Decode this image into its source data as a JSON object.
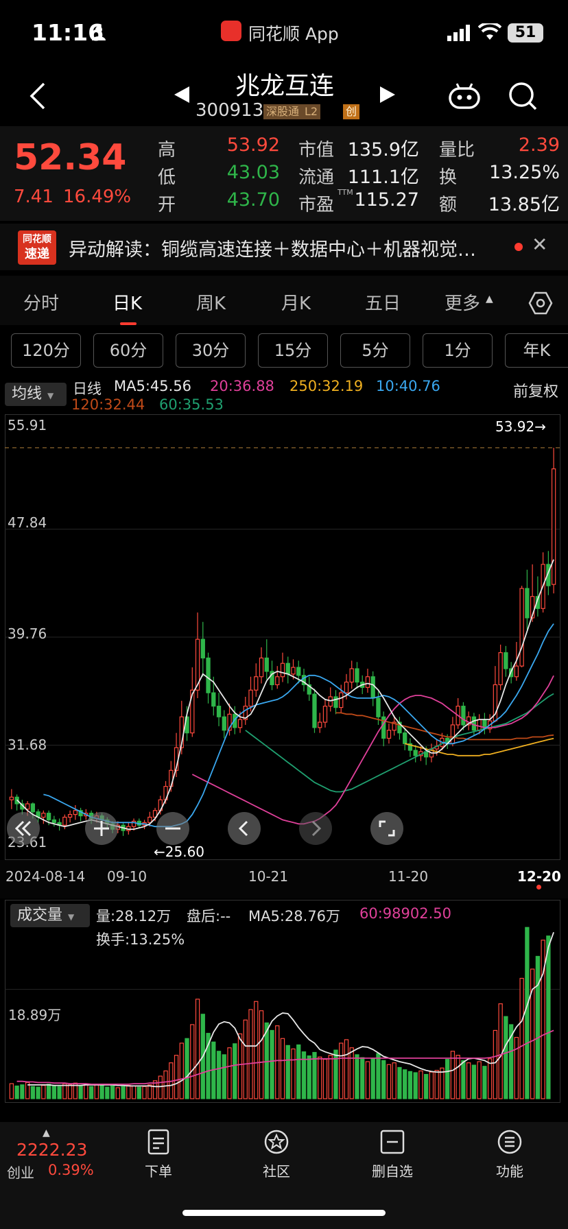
{
  "status_bar": {
    "time": "11:16",
    "app_name": "同花顺 App",
    "battery": "51"
  },
  "header": {
    "stock_name": "兆龙互连",
    "stock_code": "300913",
    "tags": [
      "深股通",
      "L2",
      "创"
    ]
  },
  "quote": {
    "price": "52.34",
    "change": "7.41",
    "change_pct": "16.49%",
    "fields": [
      {
        "label": "高",
        "value": "53.92",
        "color": "red"
      },
      {
        "label": "低",
        "value": "43.03",
        "color": "green"
      },
      {
        "label": "开",
        "value": "43.70",
        "color": "green"
      },
      {
        "label": "市值",
        "value": "135.9亿",
        "color": "white"
      },
      {
        "label": "流通",
        "value": "111.1亿",
        "color": "white"
      },
      {
        "label": "市盈",
        "sup": "TTM",
        "value": "115.27",
        "color": "white"
      },
      {
        "label": "量比",
        "value": "2.39",
        "color": "red"
      },
      {
        "label": "换",
        "value": "13.25%",
        "color": "white"
      },
      {
        "label": "额",
        "value": "13.85亿",
        "color": "white"
      }
    ]
  },
  "news": {
    "badge_top": "同花顺",
    "badge_bottom": "速递",
    "text": "异动解读：铜缆高速连接＋数据中心＋机器视觉…"
  },
  "period_tabs": [
    "分时",
    "日K",
    "周K",
    "月K",
    "五日",
    "更多"
  ],
  "minute_buttons": [
    "120分",
    "60分",
    "30分",
    "15分",
    "5分",
    "1分",
    "年K"
  ],
  "ma_legend": {
    "selector": "均线",
    "prefix": "日线",
    "items": [
      {
        "label": "MA5:45.56",
        "color": "#e8e8e8"
      },
      {
        "label": "20:36.88",
        "color": "#e0409a"
      },
      {
        "label": "250:32.19",
        "color": "#f0b020"
      },
      {
        "label": "10:40.76",
        "color": "#3aa8f0"
      },
      {
        "label": "120:32.44",
        "color": "#c04a18"
      },
      {
        "label": "60:35.53",
        "color": "#1fa070"
      }
    ],
    "fuquan": "前复权"
  },
  "chart_data": {
    "type": "candlestick",
    "y_ticks": [
      "55.91",
      "47.84",
      "39.76",
      "31.68",
      "23.61"
    ],
    "ylim": [
      23.61,
      55.91
    ],
    "x_ticks": [
      "2024-08-14",
      "09-10",
      "10-21",
      "11-20",
      "12-20"
    ],
    "high_marker": "53.92→",
    "low_marker": "←25.60",
    "candles": [
      [
        27.6,
        27.8,
        26.9,
        28.4
      ],
      [
        27.8,
        27.3,
        26.8,
        28.0
      ],
      [
        27.3,
        26.9,
        26.5,
        27.6
      ],
      [
        26.9,
        27.3,
        26.4,
        27.5
      ],
      [
        27.3,
        26.7,
        26.2,
        27.4
      ],
      [
        26.7,
        26.3,
        25.9,
        26.9
      ],
      [
        26.3,
        26.6,
        25.8,
        26.8
      ],
      [
        26.6,
        26.1,
        25.7,
        26.8
      ],
      [
        26.1,
        25.9,
        25.6,
        26.4
      ],
      [
        25.9,
        25.7,
        25.3,
        26.2
      ],
      [
        25.7,
        26.3,
        25.4,
        26.5
      ],
      [
        26.3,
        26.5,
        25.9,
        26.8
      ],
      [
        26.5,
        26.8,
        26.1,
        27.2
      ],
      [
        26.8,
        26.4,
        26.0,
        27.0
      ],
      [
        26.4,
        26.6,
        26.1,
        26.9
      ],
      [
        26.6,
        26.2,
        25.8,
        26.8
      ],
      [
        26.2,
        26.4,
        25.9,
        26.7
      ],
      [
        26.4,
        26.1,
        25.7,
        26.6
      ],
      [
        26.1,
        25.8,
        25.5,
        26.3
      ],
      [
        25.8,
        25.4,
        25.1,
        26.0
      ],
      [
        25.4,
        25.7,
        25.1,
        26.0
      ],
      [
        25.7,
        25.3,
        24.9,
        25.9
      ],
      [
        25.3,
        25.6,
        25.0,
        25.9
      ],
      [
        25.6,
        26.0,
        25.3,
        26.2
      ],
      [
        26.0,
        25.7,
        25.5,
        26.2
      ],
      [
        25.7,
        25.9,
        25.4,
        26.1
      ],
      [
        25.9,
        26.3,
        25.6,
        26.7
      ],
      [
        26.3,
        26.8,
        26.0,
        27.0
      ],
      [
        26.8,
        27.6,
        26.5,
        27.9
      ],
      [
        27.6,
        28.6,
        27.3,
        29.0
      ],
      [
        28.6,
        29.8,
        28.2,
        30.5
      ],
      [
        29.8,
        31.5,
        29.3,
        32.6
      ],
      [
        31.5,
        33.8,
        31.0,
        35.0
      ],
      [
        33.8,
        32.6,
        32.0,
        34.6
      ],
      [
        32.6,
        35.8,
        32.3,
        37.5
      ],
      [
        35.8,
        39.6,
        35.2,
        41.6
      ],
      [
        39.6,
        38.2,
        36.8,
        40.9
      ],
      [
        38.2,
        35.6,
        34.8,
        38.6
      ],
      [
        35.6,
        34.6,
        33.9,
        36.8
      ],
      [
        34.6,
        33.8,
        33.1,
        35.6
      ],
      [
        33.8,
        32.8,
        32.2,
        34.3
      ],
      [
        32.8,
        34.0,
        32.4,
        34.8
      ],
      [
        34.0,
        33.0,
        32.5,
        34.6
      ],
      [
        33.0,
        33.6,
        32.6,
        34.2
      ],
      [
        33.6,
        34.6,
        33.2,
        35.3
      ],
      [
        34.6,
        35.8,
        34.2,
        36.8
      ],
      [
        35.8,
        36.8,
        35.3,
        37.8
      ],
      [
        36.8,
        38.2,
        36.3,
        39.0
      ],
      [
        38.2,
        37.2,
        36.6,
        39.6
      ],
      [
        37.2,
        36.2,
        35.8,
        38.0
      ],
      [
        36.2,
        36.8,
        35.9,
        37.6
      ],
      [
        36.8,
        37.8,
        36.4,
        38.6
      ],
      [
        37.8,
        37.0,
        36.3,
        38.3
      ],
      [
        37.0,
        37.5,
        36.6,
        38.1
      ],
      [
        37.5,
        36.9,
        36.3,
        38.0
      ],
      [
        36.9,
        36.2,
        35.7,
        37.4
      ],
      [
        36.2,
        35.5,
        35.0,
        36.8
      ],
      [
        35.5,
        33.0,
        32.6,
        35.9
      ],
      [
        33.0,
        33.4,
        32.6,
        34.1
      ],
      [
        33.4,
        34.6,
        33.0,
        35.1
      ],
      [
        34.6,
        35.3,
        34.2,
        36.0
      ],
      [
        35.3,
        34.5,
        34.0,
        35.8
      ],
      [
        34.5,
        35.6,
        34.1,
        36.2
      ],
      [
        35.6,
        36.4,
        35.1,
        37.0
      ],
      [
        36.4,
        37.4,
        35.9,
        38.0
      ],
      [
        37.4,
        36.4,
        35.9,
        37.9
      ],
      [
        36.4,
        36.0,
        35.5,
        36.9
      ],
      [
        36.0,
        36.8,
        35.6,
        37.4
      ],
      [
        36.8,
        35.2,
        34.6,
        37.2
      ],
      [
        35.2,
        33.8,
        33.2,
        35.7
      ],
      [
        33.8,
        32.2,
        31.6,
        34.2
      ],
      [
        32.2,
        32.8,
        31.8,
        33.3
      ],
      [
        32.8,
        33.4,
        32.4,
        33.9
      ],
      [
        33.4,
        32.6,
        32.1,
        33.8
      ],
      [
        32.6,
        31.8,
        31.3,
        33.0
      ],
      [
        31.8,
        31.3,
        30.8,
        32.2
      ],
      [
        31.3,
        30.9,
        30.4,
        31.7
      ],
      [
        30.9,
        31.2,
        30.5,
        31.6
      ],
      [
        31.2,
        30.8,
        30.2,
        31.6
      ],
      [
        30.8,
        31.4,
        30.4,
        31.8
      ],
      [
        31.4,
        31.6,
        30.9,
        32.1
      ],
      [
        31.6,
        32.2,
        31.3,
        32.6
      ],
      [
        32.2,
        31.8,
        31.4,
        32.5
      ],
      [
        31.8,
        33.2,
        31.6,
        33.8
      ],
      [
        33.2,
        34.6,
        32.9,
        35.2
      ],
      [
        34.6,
        33.2,
        32.8,
        34.9
      ],
      [
        33.2,
        33.8,
        32.8,
        34.2
      ],
      [
        33.8,
        32.8,
        32.4,
        34.1
      ],
      [
        32.8,
        33.6,
        32.5,
        34.0
      ],
      [
        33.6,
        32.9,
        32.5,
        34.1
      ],
      [
        32.9,
        33.5,
        32.6,
        34.0
      ],
      [
        33.5,
        36.2,
        33.4,
        37.6
      ],
      [
        36.2,
        38.6,
        35.8,
        39.2
      ],
      [
        38.6,
        37.4,
        36.8,
        39.1
      ],
      [
        37.4,
        36.8,
        36.3,
        37.9
      ],
      [
        36.8,
        37.6,
        36.5,
        39.4
      ],
      [
        37.6,
        43.4,
        37.5,
        43.6
      ],
      [
        43.4,
        41.2,
        40.3,
        44.8
      ],
      [
        41.2,
        42.8,
        40.9,
        45.2
      ],
      [
        42.8,
        41.9,
        41.3,
        44.3
      ],
      [
        41.9,
        45.2,
        41.6,
        46.1
      ],
      [
        45.2,
        43.6,
        42.9,
        46.2
      ],
      [
        43.7,
        52.34,
        43.03,
        53.92
      ]
    ],
    "ma": {
      "ma5": [
        27.6,
        27.2,
        26.8,
        26.5,
        26.3,
        26.1,
        25.9,
        25.8,
        25.7,
        25.6,
        25.7,
        25.8,
        25.9,
        26.0,
        26.1,
        26.0,
        25.9,
        25.8,
        25.7,
        25.6,
        25.5,
        25.4,
        25.4,
        25.5,
        25.6,
        25.8,
        26.2,
        26.8,
        27.6,
        28.6,
        30.0,
        31.8,
        34.0,
        35.5,
        36.2,
        37.0,
        36.7,
        36.4,
        35.8,
        35.2,
        34.6,
        34.1,
        33.8,
        33.7,
        34.0,
        34.7,
        35.6,
        36.5,
        37.0,
        37.2,
        37.1,
        37.0,
        36.8,
        36.6,
        36.4,
        36.1,
        35.8,
        35.4,
        35.1,
        35.0,
        35.1,
        35.2,
        35.4,
        35.7,
        36.0,
        36.2,
        36.3,
        36.2,
        35.8,
        35.2,
        34.5,
        33.8,
        33.3,
        32.9,
        32.5,
        32.1,
        31.7,
        31.3,
        31.1,
        31.1,
        31.4,
        31.8,
        32.2,
        32.6,
        33.0,
        33.3,
        33.5,
        33.6,
        33.6,
        33.6,
        34.0,
        35.0,
        36.2,
        37.2,
        38.0,
        39.0,
        40.2,
        41.4,
        42.6,
        43.6,
        44.6,
        45.56
      ],
      "ma10": [
        28.0,
        27.9,
        27.7,
        27.5,
        27.3,
        27.1,
        26.9,
        26.7,
        26.5,
        26.3,
        26.2,
        26.1,
        26.0,
        25.9,
        25.9,
        25.9,
        25.9,
        25.9,
        25.8,
        25.8,
        25.7,
        25.6,
        25.6,
        25.6,
        25.6,
        25.7,
        25.8,
        26.0,
        26.5,
        27.2,
        28.0,
        29.0,
        30.0,
        31.0,
        32.0,
        33.0,
        33.6,
        34.0,
        34.3,
        34.5,
        34.7,
        34.8,
        34.9,
        35.0,
        35.1,
        35.3,
        35.6,
        36.0,
        36.4,
        36.7,
        36.9,
        36.9,
        36.8,
        36.6,
        36.4,
        36.1,
        35.8,
        35.5,
        35.3,
        35.2,
        35.2,
        35.2,
        35.2,
        35.3,
        35.4,
        35.3,
        35.1,
        34.8,
        34.4,
        34.0,
        33.6,
        33.2,
        32.8,
        32.4,
        32.1,
        31.9,
        31.8,
        31.8,
        31.9,
        32.0,
        32.2,
        32.4,
        32.6,
        32.9,
        33.2,
        33.5,
        33.8,
        34.2,
        34.8,
        35.4,
        36.1,
        36.9,
        37.7,
        38.5,
        39.4,
        40.2,
        40.76
      ],
      "ma20": [
        29.5,
        29.3,
        29.1,
        28.9,
        28.7,
        28.5,
        28.3,
        28.1,
        27.9,
        27.7,
        27.5,
        27.3,
        27.1,
        26.9,
        26.7,
        26.5,
        26.3,
        26.1,
        26.0,
        25.9,
        25.8,
        25.8,
        25.9,
        26.0,
        26.2,
        26.5,
        26.8,
        27.2,
        27.8,
        28.5,
        29.2,
        29.9,
        30.6,
        31.3,
        32.0,
        32.7,
        33.3,
        33.9,
        34.4,
        34.8,
        35.1,
        35.3,
        35.4,
        35.4,
        35.3,
        35.2,
        35.0,
        34.8,
        34.5,
        34.2,
        33.9,
        33.6,
        33.4,
        33.2,
        33.1,
        33.0,
        33.0,
        33.0,
        33.1,
        33.2,
        33.3,
        33.5,
        33.7,
        34.0,
        34.4,
        34.9,
        35.5,
        36.1,
        36.88
      ],
      "ma60": [
        32.8,
        32.5,
        32.2,
        31.9,
        31.6,
        31.3,
        31.0,
        30.7,
        30.4,
        30.1,
        29.8,
        29.5,
        29.2,
        28.9,
        28.7,
        28.5,
        28.3,
        28.2,
        28.2,
        28.3,
        28.4,
        28.6,
        28.8,
        29.0,
        29.2,
        29.4,
        29.6,
        29.8,
        30.0,
        30.2,
        30.4,
        30.6,
        30.8,
        31.0,
        31.2,
        31.4,
        31.6,
        31.8,
        32.0,
        32.2,
        32.4,
        32.5,
        32.6,
        32.7,
        32.8,
        32.9,
        33.0,
        33.1,
        33.2,
        33.3,
        33.5,
        33.7,
        33.9,
        34.1,
        34.4,
        34.7,
        35.0,
        35.3,
        35.53
      ],
      "ma120": [
        34.1,
        34.1,
        34.0,
        34.0,
        33.9,
        33.9,
        33.8,
        33.7,
        33.6,
        33.5,
        33.4,
        33.3,
        33.2,
        33.1,
        33.0,
        32.9,
        32.8,
        32.7,
        32.6,
        32.5,
        32.4,
        32.3,
        32.3,
        32.2,
        32.2,
        32.1,
        32.1,
        32.1,
        32.1,
        32.1,
        32.1,
        32.1,
        32.1,
        32.1,
        32.2,
        32.2,
        32.2,
        32.3,
        32.3,
        32.3,
        32.4,
        32.44
      ],
      "ma250": [
        31.8,
        31.7,
        31.6,
        31.5,
        31.4,
        31.3,
        31.2,
        31.1,
        31.0,
        31.0,
        30.9,
        30.9,
        30.9,
        30.9,
        30.9,
        31.0,
        31.0,
        31.1,
        31.2,
        31.3,
        31.4,
        31.5,
        31.6,
        31.7,
        31.8,
        31.9,
        32.0,
        32.1,
        32.19
      ]
    }
  },
  "volume": {
    "selector": "成交量",
    "vol": "量:28.12万",
    "after_hours": "盘后:--",
    "ma5": "MA5:28.76万",
    "ma60": "60:98902.50",
    "turnover": "换手:13.25%",
    "y_tick": "18.89万",
    "ymax": 32,
    "bars": [
      2.6,
      2.2,
      2.4,
      2.8,
      2.1,
      2.0,
      2.3,
      2.5,
      2.2,
      2.1,
      2.6,
      2.4,
      2.7,
      2.2,
      2.5,
      2.1,
      2.4,
      2.3,
      2.0,
      2.2,
      1.9,
      2.1,
      2.3,
      2.2,
      2.0,
      2.1,
      2.4,
      3.1,
      3.9,
      4.8,
      6.2,
      7.5,
      9.6,
      10.4,
      12.8,
      17.2,
      14.6,
      11.3,
      9.8,
      8.2,
      7.6,
      8.8,
      9.5,
      11.2,
      13.6,
      15.4,
      16.8,
      15.2,
      13.1,
      11.8,
      12.6,
      10.4,
      9.2,
      8.6,
      9.3,
      8.1,
      7.4,
      8.0,
      7.2,
      6.8,
      7.5,
      8.4,
      9.6,
      10.2,
      8.8,
      7.6,
      7.1,
      6.4,
      7.0,
      7.8,
      6.6,
      5.9,
      6.2,
      5.4,
      5.0,
      4.7,
      4.5,
      4.8,
      4.2,
      4.6,
      4.9,
      5.3,
      6.8,
      8.2,
      7.5,
      6.6,
      6.2,
      5.8,
      6.4,
      5.6,
      6.9,
      11.8,
      16.4,
      14.2,
      12.8,
      10.6,
      20.8,
      29.6,
      22.4,
      24.6,
      27.4,
      28.12
    ],
    "ma5_line": [
      2.4,
      2.4,
      2.4,
      2.4,
      2.4,
      2.3,
      2.3,
      2.3,
      2.3,
      2.3,
      2.3,
      2.4,
      2.4,
      2.4,
      2.4,
      2.4,
      2.4,
      2.3,
      2.3,
      2.2,
      2.2,
      2.2,
      2.2,
      2.2,
      2.1,
      2.1,
      2.2,
      2.3,
      2.6,
      3.1,
      3.8,
      4.9,
      6.0,
      7.3,
      9.3,
      11.5,
      12.9,
      13.3,
      13.1,
      12.2,
      10.3,
      9.1,
      9.1,
      9.1,
      10.1,
      11.7,
      13.4,
      14.3,
      14.8,
      14.7,
      13.6,
      12.3,
      11.2,
      10.2,
      9.6,
      8.5,
      8.1,
      7.8,
      7.5,
      7.4,
      7.6,
      8.1,
      8.6,
      9.0,
      8.9,
      8.5,
      7.9,
      7.3,
      7.0,
      6.7,
      6.4,
      6.2,
      6.0,
      5.6,
      5.2,
      4.9,
      4.7,
      4.6,
      4.6,
      4.7,
      4.9,
      5.5,
      6.3,
      6.9,
      7.0,
      6.8,
      6.6,
      6.1,
      6.2,
      7.3,
      9.3,
      10.8,
      12.4,
      13.4,
      16.1,
      18.9,
      19.6,
      21.6,
      26.2,
      28.76
    ],
    "ma60_line": [
      3.0,
      3.0,
      2.9,
      2.9,
      2.8,
      2.8,
      2.8,
      2.7,
      2.7,
      2.7,
      2.6,
      2.6,
      2.6,
      2.6,
      2.5,
      2.5,
      2.5,
      2.5,
      2.5,
      2.5,
      2.5,
      2.5,
      2.6,
      2.6,
      2.6,
      2.7,
      2.7,
      2.8,
      2.9,
      3.0,
      3.2,
      3.4,
      3.6,
      3.9,
      4.2,
      4.5,
      4.8,
      5.0,
      5.2,
      5.4,
      5.6,
      5.8,
      5.9,
      6.0,
      6.1,
      6.2,
      6.3,
      6.4,
      6.5,
      6.6,
      6.6,
      6.7,
      6.7,
      6.8,
      6.8,
      6.8,
      6.9,
      6.9,
      6.9,
      6.9,
      6.9,
      7.0,
      7.0,
      7.0,
      7.0,
      7.0,
      7.0,
      7.0,
      7.0,
      7.0,
      7.0,
      7.0,
      7.0,
      7.0,
      7.0,
      7.0,
      7.0,
      7.0,
      7.0,
      7.0,
      7.0,
      7.0,
      7.0,
      7.0,
      7.0,
      7.0,
      7.0,
      7.0,
      7.0,
      7.1,
      7.3,
      7.6,
      7.9,
      8.2,
      8.6,
      9.1,
      9.6,
      10.0,
      10.5,
      11.0,
      11.4,
      11.8
    ]
  },
  "bottom_nav": {
    "index_value": "2222.23",
    "index_name": "创业",
    "index_pct": "0.39%",
    "items": [
      "下单",
      "社区",
      "删自选",
      "功能"
    ]
  }
}
